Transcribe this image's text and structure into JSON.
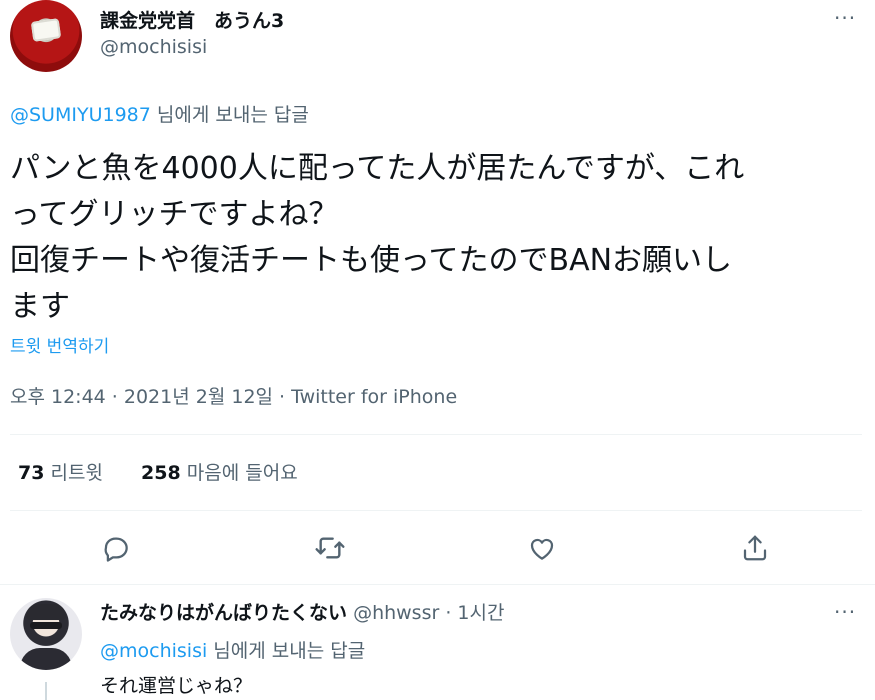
{
  "tweet": {
    "author": {
      "display_name": "課金党党首　あうん3",
      "handle": "@mochisisi"
    },
    "reply_to": {
      "mention": "@SUMIYU1987",
      "suffix": " 님에게 보내는 답글"
    },
    "body_lines": [
      "パンと魚を4000人に配ってた人が居たんですが、これ",
      "ってグリッチですよね？",
      "回復チートや復活チートも使ってたのでBANお願いし",
      "ます"
    ],
    "translate_label": "트윗 번역하기",
    "meta": "오후 12:44 · 2021년 2월 12일 · Twitter for iPhone",
    "stats": {
      "retweets_count": "73",
      "retweets_label": "리트윗",
      "likes_count": "258",
      "likes_label": "마음에 들어요"
    },
    "icons": [
      "reply-icon",
      "retweet-icon",
      "like-icon",
      "share-icon"
    ],
    "more_label": "···"
  },
  "reply": {
    "display_name": "たみなりはがんばりたくない",
    "handle": "@hhwssr",
    "time": "· 1시간",
    "reply_to": {
      "mention": "@mochisisi",
      "suffix": " 님에게 보내는 답글"
    },
    "text": "それ運営じゃね？",
    "more_label": "···"
  },
  "colors": {
    "link": "#1d9bf0",
    "secondary": "#536471",
    "text": "#0f1419"
  }
}
